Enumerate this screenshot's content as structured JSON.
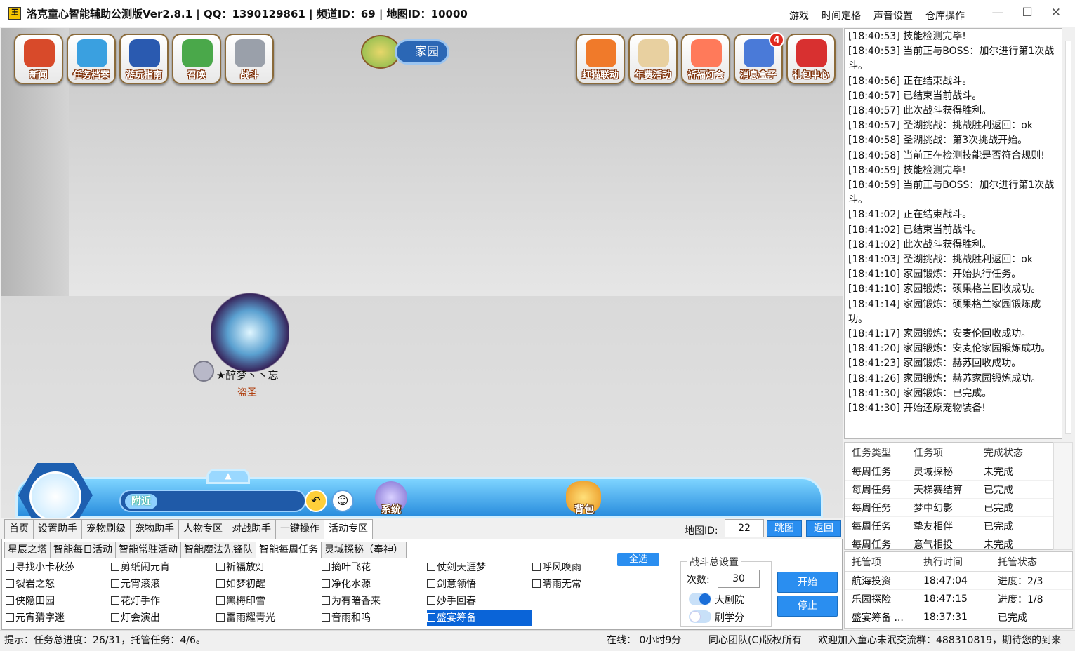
{
  "window": {
    "icon_text": "王",
    "title": "洛克童心智能辅助公测版Ver2.8.1 | QQ：1390129861 | 频道ID：69 | 地图ID：10000",
    "menu": [
      "游戏",
      "时间定格",
      "声音设置",
      "仓库操作"
    ],
    "minimize": "—",
    "maximize": "☐",
    "close": "✕"
  },
  "game": {
    "top_left_buttons": [
      "新闻",
      "任务档案",
      "游玩指南",
      "召唤",
      "战斗"
    ],
    "location": "家园",
    "top_right_buttons": [
      "虹猫联动",
      "年费活动",
      "祈福灯会",
      "消息盒子",
      "礼包中心"
    ],
    "message_badge": "4",
    "pet_name": "★醉梦丶丶忘",
    "pet_title": "盗圣",
    "chat_channel": "附近",
    "system_label": "系统",
    "bag_label": "背包"
  },
  "log": [
    "[18:40:53] 技能检测完毕!",
    "[18:40:53] 当前正与BOSS：加尔进行第1次战斗。",
    "[18:40:56] 正在结束战斗。",
    "[18:40:57] 已结束当前战斗。",
    "[18:40:57] 此次战斗获得胜利。",
    "[18:40:57] 圣湖挑战：挑战胜利返回：ok",
    "[18:40:58] 圣湖挑战：第3次挑战开始。",
    "[18:40:58] 当前正在检测技能是否符合规则!",
    "[18:40:59] 技能检测完毕!",
    "[18:40:59] 当前正与BOSS：加尔进行第1次战斗。",
    "[18:41:02] 正在结束战斗。",
    "[18:41:02] 已结束当前战斗。",
    "[18:41:02] 此次战斗获得胜利。",
    "[18:41:03] 圣湖挑战：挑战胜利返回：ok",
    "[18:41:10] 家园锻炼：开始执行任务。",
    "[18:41:10] 家园锻炼：硕果格兰回收成功。",
    "[18:41:14] 家园锻炼：硕果格兰家园锻炼成功。",
    "[18:41:17] 家园锻炼：安麦伦回收成功。",
    "[18:41:20] 家园锻炼：安麦伦家园锻炼成功。",
    "[18:41:23] 家园锻炼：赫苏回收成功。",
    "[18:41:26] 家园锻炼：赫苏家园锻炼成功。",
    "[18:41:30] 家园锻炼：已完成。",
    "[18:41:30] 开始还原宠物装备!"
  ],
  "tasks": {
    "headers": [
      "任务类型",
      "任务项",
      "完成状态"
    ],
    "rows": [
      [
        "每周任务",
        "灵域探秘",
        "未完成"
      ],
      [
        "每周任务",
        "天梯赛结算",
        "已完成"
      ],
      [
        "每周任务",
        "梦中幻影",
        "已完成"
      ],
      [
        "每周任务",
        "挚友相伴",
        "已完成"
      ],
      [
        "每周任务",
        "意气相投",
        "未完成"
      ]
    ]
  },
  "trusts": {
    "headers": [
      "托管项",
      "执行时间",
      "托管状态"
    ],
    "rows": [
      [
        "航海投资",
        "18:47:04",
        "进度：2/3"
      ],
      [
        "乐园探险",
        "18:47:15",
        "进度：1/8"
      ],
      [
        "盛宴筹备 ...",
        "18:37:31",
        "已完成"
      ]
    ]
  },
  "main_tabs": [
    "首页",
    "设置助手",
    "宠物刷级",
    "宠物助手",
    "人物专区",
    "对战助手",
    "一键操作",
    "活动专区"
  ],
  "map_id": {
    "label": "地图ID:",
    "value": "22",
    "jump": "跳图",
    "back": "返回"
  },
  "sub_tabs": [
    "星辰之塔",
    "智能每日活动",
    "智能常驻活动",
    "智能魔法先锋队",
    "智能每周任务",
    "灵域探秘（奉神）"
  ],
  "checks": [
    [
      "寻找小卡秋莎",
      "裂岩之怒",
      "侠隐田园",
      "元宵猜字迷"
    ],
    [
      "剪纸闹元宵",
      "元宵滚滚",
      "花灯手作",
      "灯会演出"
    ],
    [
      "祈福放灯",
      "如梦初醒",
      "黑梅印雪",
      "雷雨耀青光"
    ],
    [
      "摘叶飞花",
      "净化水源",
      "为有暗香来",
      "音雨和鸣"
    ],
    [
      "仗剑天涯梦",
      "剑意领悟",
      "妙手回春",
      "盛宴筹备"
    ],
    [
      "呼风唤雨",
      "晴雨无常"
    ]
  ],
  "select_all": "全选",
  "battle": {
    "title": "战斗总设置",
    "count_label": "次数:",
    "count_value": "30",
    "option1": "大剧院",
    "option2": "刷学分",
    "start": "开始",
    "stop": "停止"
  },
  "status": {
    "hint": "提示：任务总进度：26/31，托管任务：4/6。",
    "online": "在线：  0小时9分",
    "copyright": "同心团队(C)版权所有",
    "welcome": "欢迎加入童心未泯交流群：488310819，期待您的到来"
  }
}
